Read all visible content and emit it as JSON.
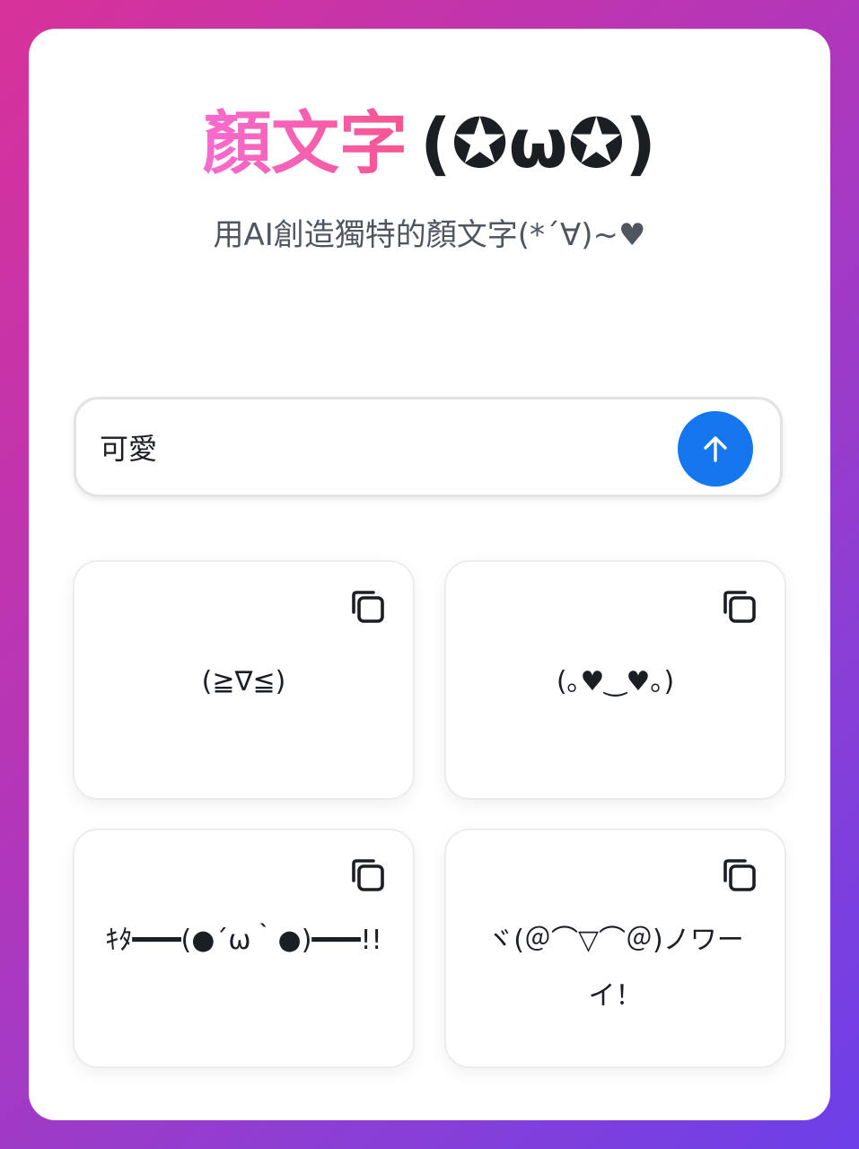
{
  "header": {
    "title": "顏文字",
    "title_face": "(✪ω✪)",
    "subtitle": "用AI創造獨特的顏文字(*´∀)~♥"
  },
  "search": {
    "value": "可愛",
    "send_icon": "arrow-up-icon"
  },
  "results": [
    {
      "kaomoji": "(≧∇≦)",
      "copy_icon": "copy-icon"
    },
    {
      "kaomoji": "(｡♥‿♥｡)",
      "copy_icon": "copy-icon"
    },
    {
      "kaomoji": "ｷﾀ━━━(●´ω｀●)━━━!!",
      "copy_icon": "copy-icon"
    },
    {
      "kaomoji": "ヾ(＠⌒▽⌒＠)ノワーイ！",
      "copy_icon": "copy-icon"
    }
  ],
  "colors": {
    "accent": "#1577ee",
    "title_gradient_start": "#f76bd0",
    "title_gradient_end": "#f5558f",
    "background_gradient_start": "#d8329a",
    "background_gradient_end": "#6c3fe8"
  }
}
